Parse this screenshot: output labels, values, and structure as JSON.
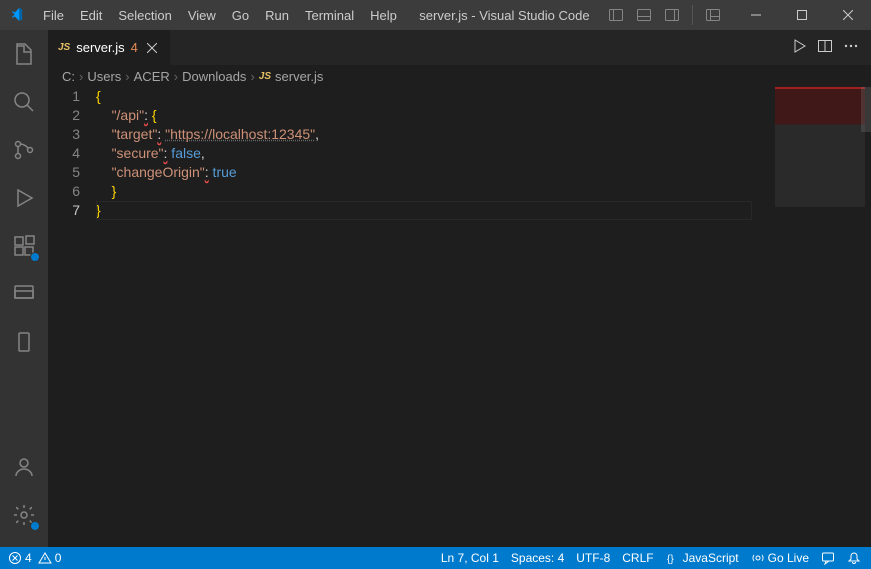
{
  "titlebar": {
    "menus": [
      "File",
      "Edit",
      "Selection",
      "View",
      "Go",
      "Run",
      "Terminal",
      "Help"
    ],
    "title": "server.js - Visual Studio Code"
  },
  "tabs": {
    "file_icon": "JS",
    "file_name": "server.js",
    "problems_badge": "4"
  },
  "breadcrumbs": {
    "parts": [
      "C:",
      "Users",
      "ACER",
      "Downloads"
    ],
    "file_icon": "JS",
    "file": "server.js"
  },
  "code": {
    "line_numbers": [
      "1",
      "2",
      "3",
      "4",
      "5",
      "6",
      "7"
    ],
    "current_line_index": 6,
    "l1_brace": "{",
    "l2_key": "\"/api\"",
    "l2_colon": ":",
    "l2_brace": " {",
    "l3_key": "\"target\"",
    "l3_colon": ":",
    "l3_val": "\"https://localhost:12345\"",
    "l3_comma": ",",
    "l4_key": "\"secure\"",
    "l4_colon": ":",
    "l4_val": " false",
    "l4_comma": ",",
    "l5_key": "\"changeOrigin\"",
    "l5_colon": ":",
    "l5_val": " true",
    "l6_brace": "}",
    "l7_brace": "}"
  },
  "statusbar": {
    "errors": "4",
    "warnings": "0",
    "ln_col": "Ln 7, Col 1",
    "spaces": "Spaces: 4",
    "encoding": "UTF-8",
    "eol": "CRLF",
    "language": "JavaScript",
    "go_live": "Go Live"
  }
}
